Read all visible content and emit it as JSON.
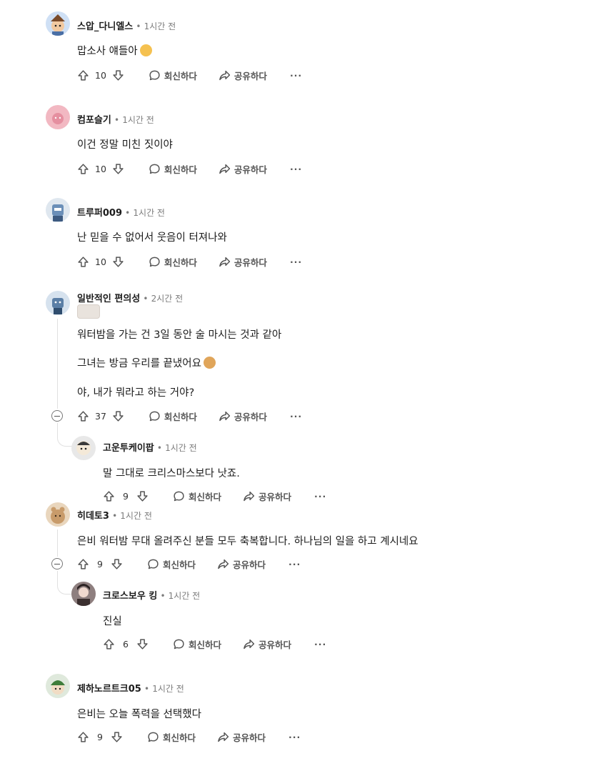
{
  "labels": {
    "reply": "회신하다",
    "share": "공유하다",
    "more": "···",
    "sep": "•"
  },
  "comments": [
    {
      "user": "스압_다니엘스",
      "time": "1시간 전",
      "text": "맙소사 얘들아",
      "votes": "10"
    },
    {
      "user": "컴포슬기",
      "time": "1시간 전",
      "text": "이건 정말 미친 짓이야",
      "votes": "10"
    },
    {
      "user": "트루퍼009",
      "time": "1시간 전",
      "text": "난 믿을 수 없어서 웃음이 터져나와",
      "votes": "10"
    },
    {
      "user": "일반적인 편의성",
      "time": "2시간 전",
      "lines": [
        "워터밤을 가는 건 3일 동안 술 마시는 것과 같아",
        "그녀는 방금 우리를 끝냈어요",
        "야, 내가 뭐라고 하는 거야?"
      ],
      "votes": "37"
    },
    {
      "user": "고운투케이팝",
      "time": "1시간 전",
      "text": "말 그대로 크리스마스보다 낫죠.",
      "votes": "9"
    },
    {
      "user": "히데토3",
      "time": "1시간 전",
      "text": "은비 워터밤 무대 올려주신 분들 모두 축복합니다. 하나님의 일을 하고 계시네요",
      "votes": "9"
    },
    {
      "user": "크로스보우 킹",
      "time": "1시간 전",
      "text": "진실",
      "votes": "6"
    },
    {
      "user": "제하노르트크05",
      "time": "1시간 전",
      "text": "은비는 오늘 폭력을 선택했다",
      "votes": "9"
    }
  ]
}
